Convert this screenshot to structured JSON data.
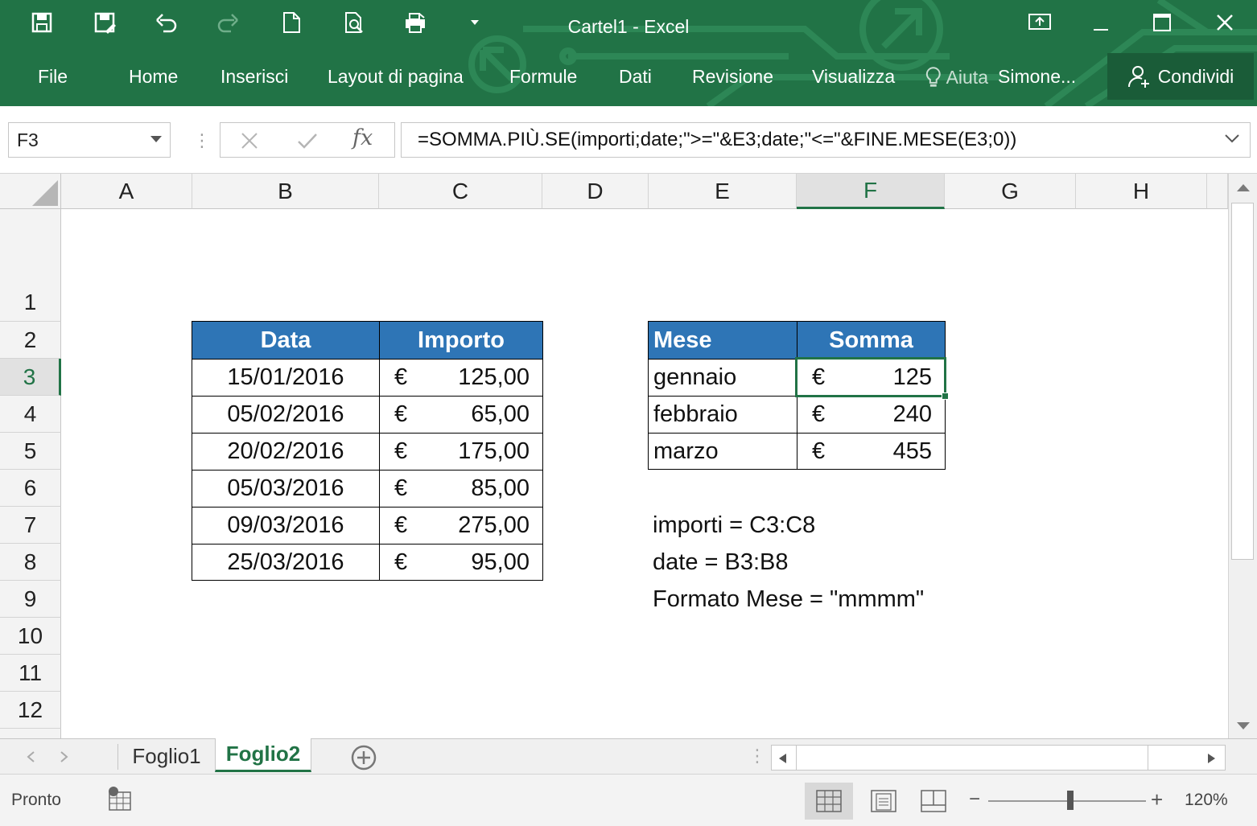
{
  "window": {
    "title": "Cartel1 - Excel"
  },
  "ribbon": {
    "tabs": [
      "File",
      "Home",
      "Inserisci",
      "Layout di pagina",
      "Formule",
      "Dati",
      "Revisione",
      "Visualizza"
    ],
    "tell_me": "Aiuta",
    "user": "Simone...",
    "share": "Condividi"
  },
  "formula_bar": {
    "name_box": "F3",
    "fx": "fx",
    "formula": "=SOMMA.PIÙ.SE(importi;date;\">=\"&E3;date;\"<=\"&FINE.MESE(E3;0))"
  },
  "grid": {
    "columns": [
      "A",
      "B",
      "C",
      "D",
      "E",
      "F",
      "G",
      "H"
    ],
    "rows": [
      "1",
      "2",
      "3",
      "4",
      "5",
      "6",
      "7",
      "8",
      "9",
      "10",
      "11",
      "12"
    ],
    "selected_column": "F",
    "selected_row": "3",
    "data_table": {
      "headers": [
        "Data",
        "Importo"
      ],
      "currency": "€",
      "rows": [
        {
          "date": "15/01/2016",
          "amount": "125,00"
        },
        {
          "date": "05/02/2016",
          "amount": "65,00"
        },
        {
          "date": "20/02/2016",
          "amount": "175,00"
        },
        {
          "date": "05/03/2016",
          "amount": "85,00"
        },
        {
          "date": "09/03/2016",
          "amount": "275,00"
        },
        {
          "date": "25/03/2016",
          "amount": "95,00"
        }
      ]
    },
    "summary_table": {
      "headers": [
        "Mese",
        "Somma"
      ],
      "currency": "€",
      "rows": [
        {
          "month": "gennaio",
          "sum": "125"
        },
        {
          "month": "febbraio",
          "sum": "240"
        },
        {
          "month": "marzo",
          "sum": "455"
        }
      ]
    },
    "notes": [
      "importi = C3:C8",
      "date = B3:B8",
      "Formato Mese = \"mmmm\""
    ]
  },
  "sheets": {
    "tabs": [
      "Foglio1",
      "Foglio2"
    ],
    "active": "Foglio2"
  },
  "status": {
    "ready": "Pronto",
    "zoom": "120%"
  },
  "colors": {
    "excel_green": "#217346",
    "header_blue": "#2e75b6"
  }
}
